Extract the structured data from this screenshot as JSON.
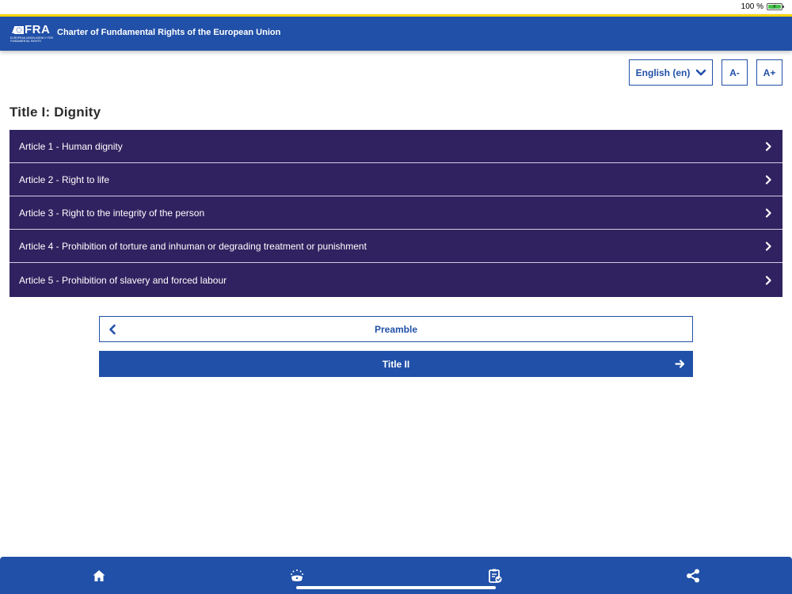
{
  "status_bar": {
    "battery_percent": "100 %",
    "battery_level": 1.0
  },
  "header": {
    "logo_text": "FRA",
    "logo_subtext": "EUROPEAN UNION AGENCY FOR FUNDAMENTAL RIGHTS",
    "title": "Charter of Fundamental Rights of the European Union"
  },
  "controls": {
    "language_label": "English (en)",
    "font_decrease_label": "A-",
    "font_increase_label": "A+"
  },
  "section_title": "Title I: Dignity",
  "articles": [
    {
      "label": "Article 1 - Human dignity"
    },
    {
      "label": "Article 2 - Right to life"
    },
    {
      "label": "Article 3 - Right to the integrity of the person"
    },
    {
      "label": "Article 4 - Prohibition of torture and inhuman or degrading treatment or punishment"
    },
    {
      "label": "Article 5 - Prohibition of slavery and forced labour"
    }
  ],
  "navigation": {
    "previous_label": "Preamble",
    "next_label": "Title II"
  },
  "bottom_tabs": [
    {
      "icon": "home-icon"
    },
    {
      "icon": "eu-stars-icon"
    },
    {
      "icon": "checklist-icon"
    },
    {
      "icon": "share-icon"
    }
  ],
  "colors": {
    "primary_blue": "#2150a8",
    "article_purple": "#302260",
    "header_accent": "#f5d400"
  }
}
